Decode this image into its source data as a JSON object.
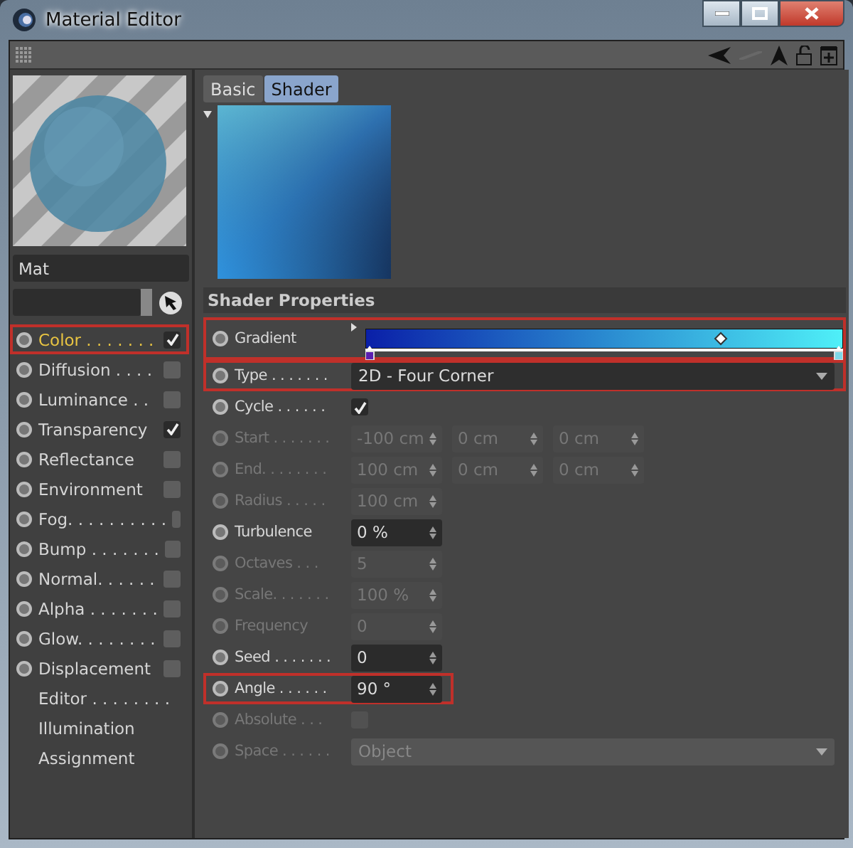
{
  "window": {
    "title": "Material Editor"
  },
  "material": {
    "name": "Mat"
  },
  "tabs": [
    {
      "label": "Basic",
      "selected": false
    },
    {
      "label": "Shader",
      "selected": true
    }
  ],
  "channels": [
    {
      "kind": "channel",
      "label": "Color . . . . . . .",
      "checked": true,
      "selected": true,
      "highlighted": true
    },
    {
      "kind": "channel",
      "label": "Diffusion . . . .",
      "checked": false,
      "selected": false,
      "highlighted": false
    },
    {
      "kind": "channel",
      "label": "Luminance . .",
      "checked": false,
      "selected": false,
      "highlighted": false
    },
    {
      "kind": "channel",
      "label": "Transparency",
      "checked": true,
      "selected": false,
      "highlighted": false
    },
    {
      "kind": "channel",
      "label": "Reflectance",
      "checked": false,
      "selected": false,
      "highlighted": false
    },
    {
      "kind": "channel",
      "label": "Environment",
      "checked": false,
      "selected": false,
      "highlighted": false
    },
    {
      "kind": "channel",
      "label": "Fog. . . . . . . . . .",
      "checked": false,
      "selected": false,
      "highlighted": false
    },
    {
      "kind": "channel",
      "label": "Bump . . . . . . .",
      "checked": false,
      "selected": false,
      "highlighted": false
    },
    {
      "kind": "channel",
      "label": "Normal. . . . . .",
      "checked": false,
      "selected": false,
      "highlighted": false
    },
    {
      "kind": "channel",
      "label": "Alpha . . . . . . .",
      "checked": false,
      "selected": false,
      "highlighted": false
    },
    {
      "kind": "channel",
      "label": "Glow. . . . . . . .",
      "checked": false,
      "selected": false,
      "highlighted": false
    },
    {
      "kind": "channel",
      "label": "Displacement",
      "checked": false,
      "selected": false,
      "highlighted": false
    },
    {
      "kind": "page",
      "label": "Editor . . . . . . . .",
      "selected": false,
      "highlighted": false
    },
    {
      "kind": "page",
      "label": "Illumination",
      "selected": false,
      "highlighted": false
    },
    {
      "kind": "page",
      "label": "Assignment",
      "selected": false,
      "highlighted": false
    }
  ],
  "section_title": "Shader Properties",
  "properties": [
    {
      "kind": "gradient",
      "label": "Gradient",
      "enabled": true,
      "highlighted": true
    },
    {
      "kind": "dropdown",
      "label": "Type . . . . . . .",
      "value": "2D - Four Corner",
      "enabled": true,
      "highlighted": true
    },
    {
      "kind": "checkbox",
      "label": "Cycle . . . . . .",
      "checked": true,
      "enabled": true,
      "highlighted": false
    },
    {
      "kind": "vector",
      "label": "Start . . . . . . .",
      "values": [
        "-100 cm",
        "0 cm",
        "0 cm"
      ],
      "enabled": false,
      "highlighted": false
    },
    {
      "kind": "vector",
      "label": "End. . . . . . . .",
      "values": [
        "100 cm",
        "0 cm",
        "0 cm"
      ],
      "enabled": false,
      "highlighted": false
    },
    {
      "kind": "number",
      "label": "Radius . . . . .",
      "value": "100 cm",
      "enabled": false,
      "highlighted": false
    },
    {
      "kind": "number",
      "label": "Turbulence",
      "value": "0 %",
      "enabled": true,
      "highlighted": false
    },
    {
      "kind": "number",
      "label": "Octaves . . .",
      "value": "5",
      "enabled": false,
      "highlighted": false
    },
    {
      "kind": "number",
      "label": "Scale. . . . . . .",
      "value": "100 %",
      "enabled": false,
      "highlighted": false
    },
    {
      "kind": "number",
      "label": "Frequency",
      "value": "0",
      "enabled": false,
      "highlighted": false
    },
    {
      "kind": "number",
      "label": "Seed . . . . . . .",
      "value": "0",
      "enabled": true,
      "highlighted": false
    },
    {
      "kind": "number",
      "label": "Angle . . . . . .",
      "value": "90 °",
      "enabled": true,
      "highlighted": true
    },
    {
      "kind": "checkbox",
      "label": "Absolute . . .",
      "checked": false,
      "enabled": false,
      "highlighted": false
    },
    {
      "kind": "dropdown",
      "label": "Space . . . . . .",
      "value": "Object",
      "enabled": false,
      "highlighted": false
    }
  ]
}
